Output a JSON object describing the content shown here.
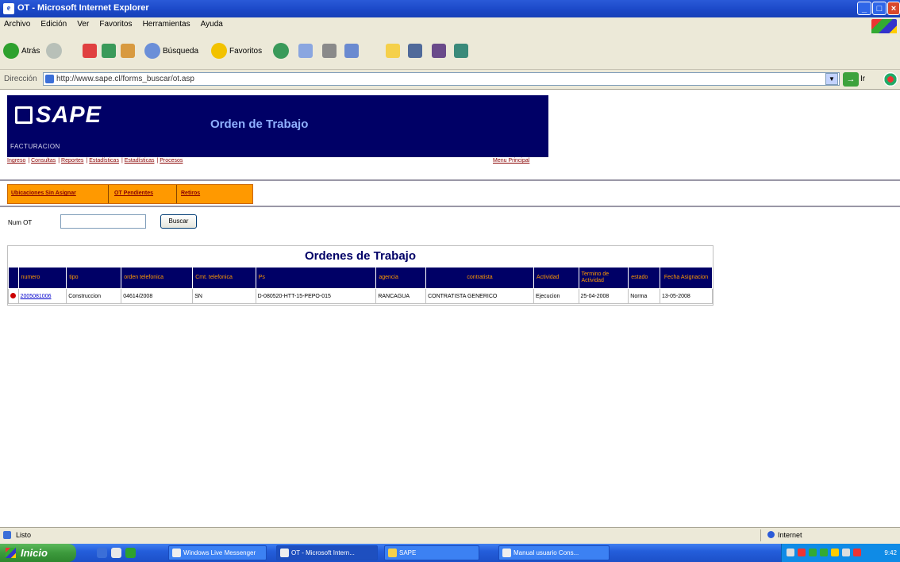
{
  "window": {
    "title": "OT - Microsoft Internet Explorer"
  },
  "menu": [
    "Archivo",
    "Edición",
    "Ver",
    "Favoritos",
    "Herramientas",
    "Ayuda"
  ],
  "toolbar": {
    "back": "Atrás",
    "search": "Búsqueda",
    "favorites": "Favoritos"
  },
  "address": {
    "label": "Dirección",
    "url": "http://www.sape.cl/forms_buscar/ot.asp",
    "go": "Ir"
  },
  "header": {
    "logo": "SAPE",
    "subtitle": "FACTURACION",
    "page_title": "Orden de Trabajo"
  },
  "nav": {
    "links": [
      "Ingreso",
      "Consultas",
      "Reportes",
      "Estadísticas",
      "Estadísticas",
      "Procesos"
    ],
    "main_menu": "Menu Principal"
  },
  "tabs": [
    "Ubicaciones Sin Asignar",
    "OT Pendientes",
    "Retiros"
  ],
  "search": {
    "label": "Num OT",
    "value": "",
    "button": "Buscar"
  },
  "orders": {
    "title": "Ordenes de Trabajo",
    "columns": [
      "",
      "numero",
      "tipo",
      "orden telefonica",
      "Cmt. telefonica",
      "Ps",
      "agencia",
      "contratista",
      "Actividad",
      "Termino de Actividad",
      "estado",
      "Fecha Asignacion"
    ],
    "rows": [
      [
        "",
        "2005081006",
        "Construccion",
        "04614/2008",
        "SN",
        "D-080520-HTT-15-PEPO-015",
        "RANCAGUA",
        "CONTRATISTA GENERICO",
        "Ejecucion",
        "25-04-2008",
        "Norma",
        "13-05-2008"
      ]
    ]
  },
  "status": {
    "message": "Listo",
    "zone": "Internet"
  },
  "taskbar": {
    "start": "Inicio",
    "buttons": [
      "Windows Live Messenger",
      "OT - Microsoft Intern...",
      "SAPE",
      "Manual usuario Cons..."
    ],
    "clock": "9:42"
  },
  "colors": {
    "header_bg": "#000066",
    "tab_bg": "#ff9900",
    "table_header_text": "#ff9900"
  }
}
